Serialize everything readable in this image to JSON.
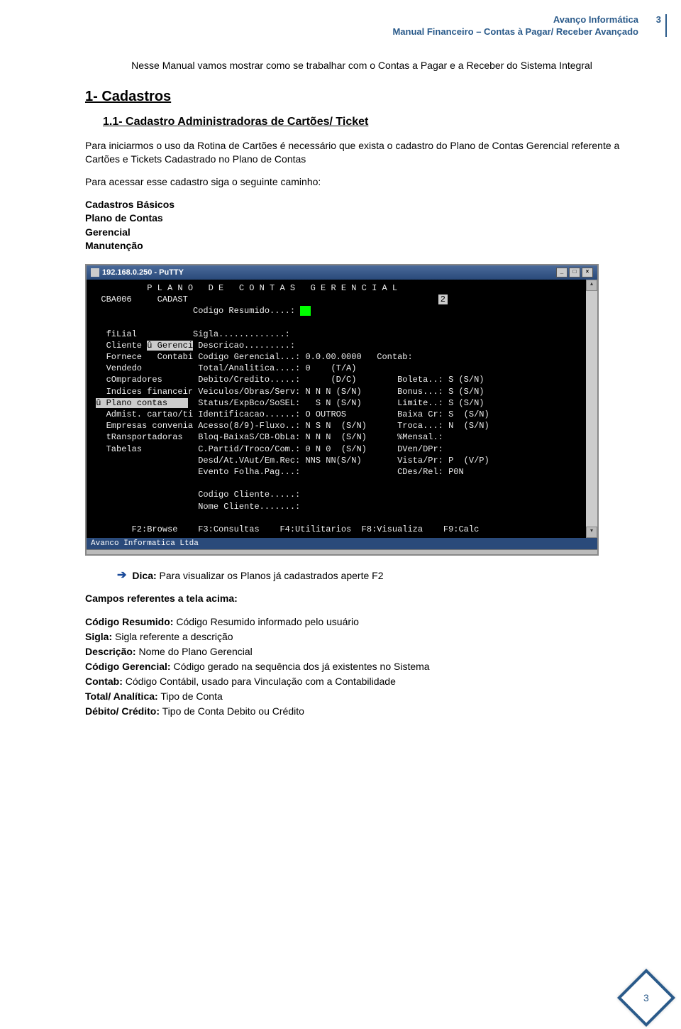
{
  "header": {
    "company": "Avanço Informática",
    "doc_title": "Manual Financeiro – Contas à Pagar/ Receber Avançado",
    "page_top_num": "3"
  },
  "intro": "Nesse Manual vamos mostrar como se trabalhar com o Contas a Pagar e a Receber do Sistema Integral",
  "h1": "1- Cadastros",
  "h2": "1.1- Cadastro Administradoras de Cartões/ Ticket",
  "p1": "Para iniciarmos o uso da Rotina de Cartões é necessário que exista o cadastro do Plano de Contas Gerencial referente a Cartões e Tickets Cadastrado no Plano de Contas",
  "p2": "Para acessar esse cadastro siga o seguinte caminho:",
  "path": {
    "l1": "Cadastros Básicos",
    "l2": "Plano de Contas",
    "l3": "Gerencial",
    "l4": "Manutenção"
  },
  "terminal": {
    "title": "192.168.0.250 - PuTTY",
    "status": "Avanco Informatica Ltda",
    "top_title": "           P L A N O   D E   C O N T A S   G E R E N C I A L",
    "line_prog": "  CBA006     CADAST",
    "page2": "2",
    "line_cod": "                    Codigo Resumido....: ",
    "cursor": "  ",
    "line_sigla": "   fiLial           Sigla.............:",
    "line_cli": "   Cliente ",
    "cli_hi": "û Gerenci",
    "line_desc": "Descricao.........:",
    "line_forn": "   Fornece   Contabi Codigo Gerencial...: 0.0.00.0000   Contab:",
    "line_vend": "   Vendedo           Total/Analitica....: 0    (T/A)",
    "line_comp": "   cOmpradores       Debito/Credito.....:      (D/C)        Boleta..: S (S/N)",
    "line_ind": "   Indices financeir Veiculos/Obras/Serv: N N N (S/N)       Bonus...: S (S/N)",
    "line_plano_hi": "û Plano contas    ",
    "line_plano_r": "Status/ExpBco/SoSEL:   S N (S/N)       Limite..: S (S/N)",
    "line_adm": "   Admist. cartao/ti Identificacao......: O OUTROS          Baixa Cr: S  (S/N)",
    "line_emp": "   Empresas convenia Acesso(8/9)-Fluxo..: N S N  (S/N)      Troca...: N  (S/N)",
    "line_trans": "   tRansportadoras   Bloq-BaixaS/CB-ObLa: N N N  (S/N)      %Mensal.:",
    "line_tab": "   Tabelas           C.Partid/Troco/Com.: 0 N 0  (S/N)      DVen/DPr:",
    "line_desd": "                     Desd/At.VAut/Em.Rec: NNS NN(S/N)       Vista/Pr: P  (V/P)",
    "line_ev": "                     Evento Folha.Pag...:                   CDes/Rel: P0N",
    "line_codcli": "                     Codigo Cliente.....:",
    "line_nomecli": "                     Nome Cliente.......:",
    "fkeys": "        F2:Browse    F3:Consultas    F4:Utilitarios  F8:Visualiza    F9:Calc"
  },
  "tip_label": "Dica:",
  "tip_text": " Para visualizar os Planos já cadastrados aperte F2",
  "fields_title": "Campos referentes a tela acima:",
  "fields": {
    "cod_res_b": "Código Resumido:",
    "cod_res_t": " Código Resumido informado pelo usuário",
    "sigla_b": "Sigla:",
    "sigla_t": " Sigla referente a descrição",
    "desc_b": "Descrição:",
    "desc_t": " Nome do Plano Gerencial",
    "codg_b": "Código Gerencial:",
    "codg_t": " Código gerado na sequência dos já existentes no Sistema",
    "cont_b": "Contab:",
    "cont_t": " Código Contábil, usado para Vinculação com a Contabilidade",
    "tot_b": "Total/ Analítica:",
    "tot_t": " Tipo de Conta",
    "deb_b": "Débito/ Crédito:",
    "deb_t": " Tipo de Conta Debito ou Crédito"
  },
  "page_bottom_num": "3"
}
